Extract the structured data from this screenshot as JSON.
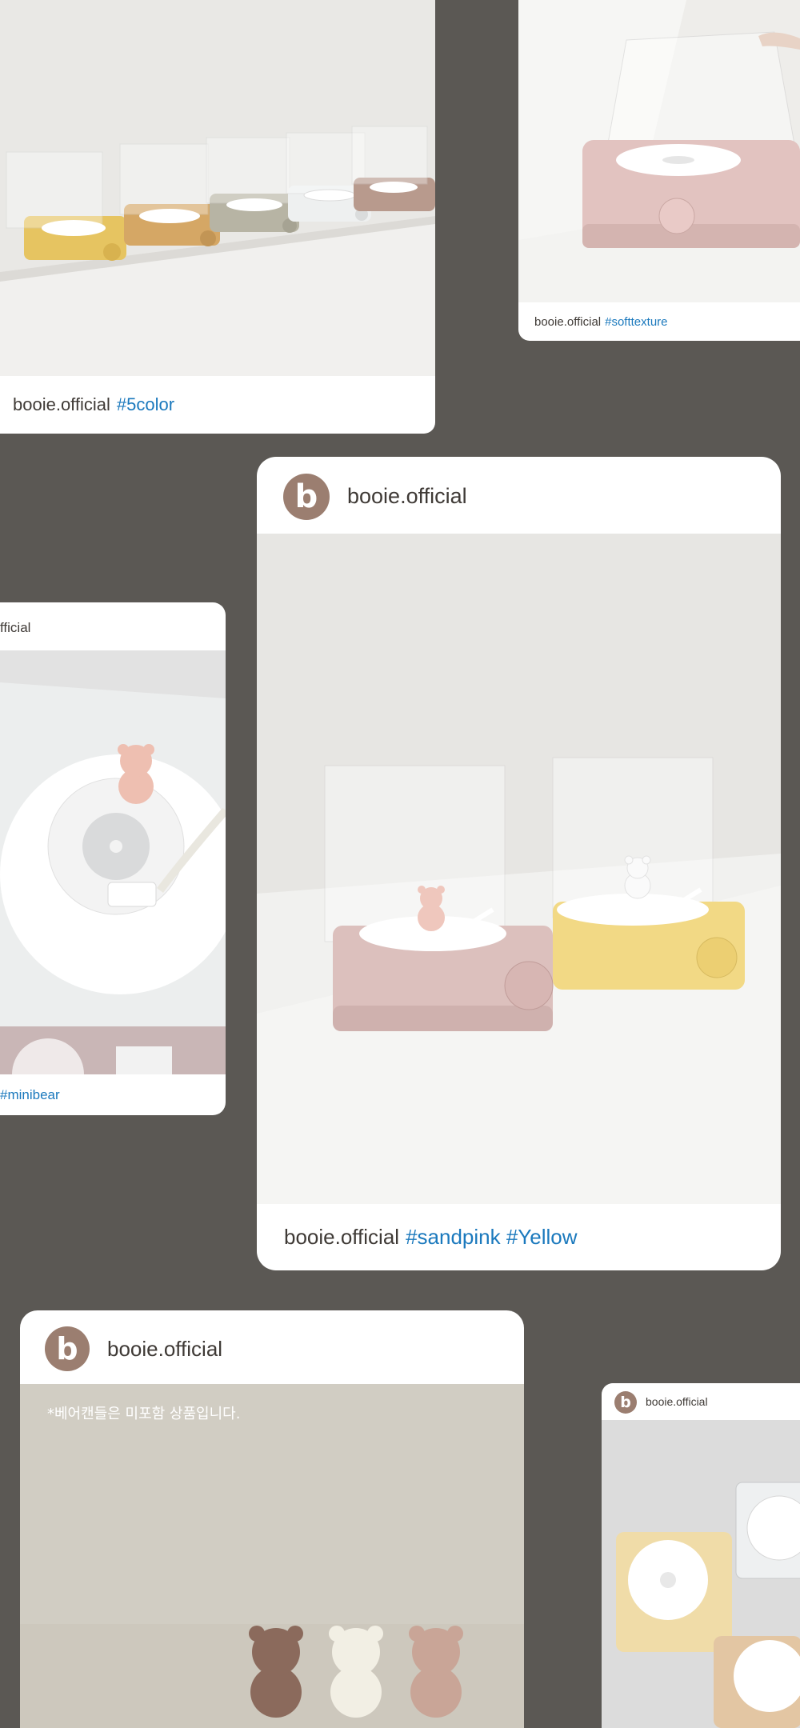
{
  "brand": {
    "avatar_letter": "b",
    "accent_hashtag_color": "#1b79bd",
    "avatar_color": "#9b7e70",
    "background_color": "#5b5854"
  },
  "cards": [
    {
      "id": "five-color",
      "caption_user": "booie.official",
      "caption_tags": "#5color"
    },
    {
      "id": "soft-texture",
      "caption_user": "booie.official",
      "caption_tags": "#softtexture"
    },
    {
      "id": "sandpink-yellow",
      "header_user": "booie.official",
      "caption_user": "booie.official",
      "caption_tags": "#sandpink #Yellow"
    },
    {
      "id": "mini-bear",
      "header_user_partial": "fficial",
      "caption_tags": "#minibear"
    },
    {
      "id": "bear-candles",
      "header_user": "booie.official",
      "overlay_note": "*베어캔들은 미포함 상품입니다."
    },
    {
      "id": "colors-top-view",
      "header_user": "booie.official"
    }
  ]
}
